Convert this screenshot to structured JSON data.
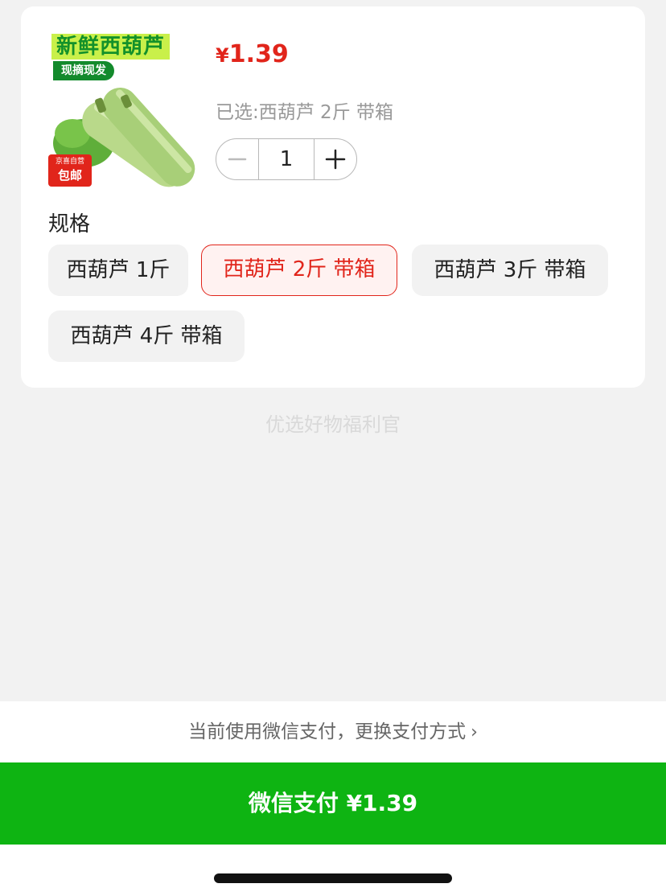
{
  "product": {
    "image_title": "新鲜西葫芦",
    "image_subtitle": "现摘现发",
    "image_badge_top": "京喜自营",
    "image_badge_main": "包邮",
    "price_symbol": "¥",
    "price_value": "1.39",
    "selected_text": "已选:西葫芦 2斤 带箱",
    "quantity": "1"
  },
  "spec": {
    "label": "规格",
    "options": [
      {
        "label": "西葫芦 1斤",
        "selected": false
      },
      {
        "label": "西葫芦 2斤 带箱",
        "selected": true
      },
      {
        "label": "西葫芦 3斤 带箱",
        "selected": false
      },
      {
        "label": "西葫芦 4斤 带箱",
        "selected": false
      }
    ]
  },
  "footer_note": "优选好物福利官",
  "payment": {
    "switch_text": "当前使用微信支付，更换支付方式",
    "pay_button": "微信支付 ¥1.39"
  },
  "colors": {
    "accent_red": "#e1251b",
    "pay_green": "#0eb412"
  }
}
